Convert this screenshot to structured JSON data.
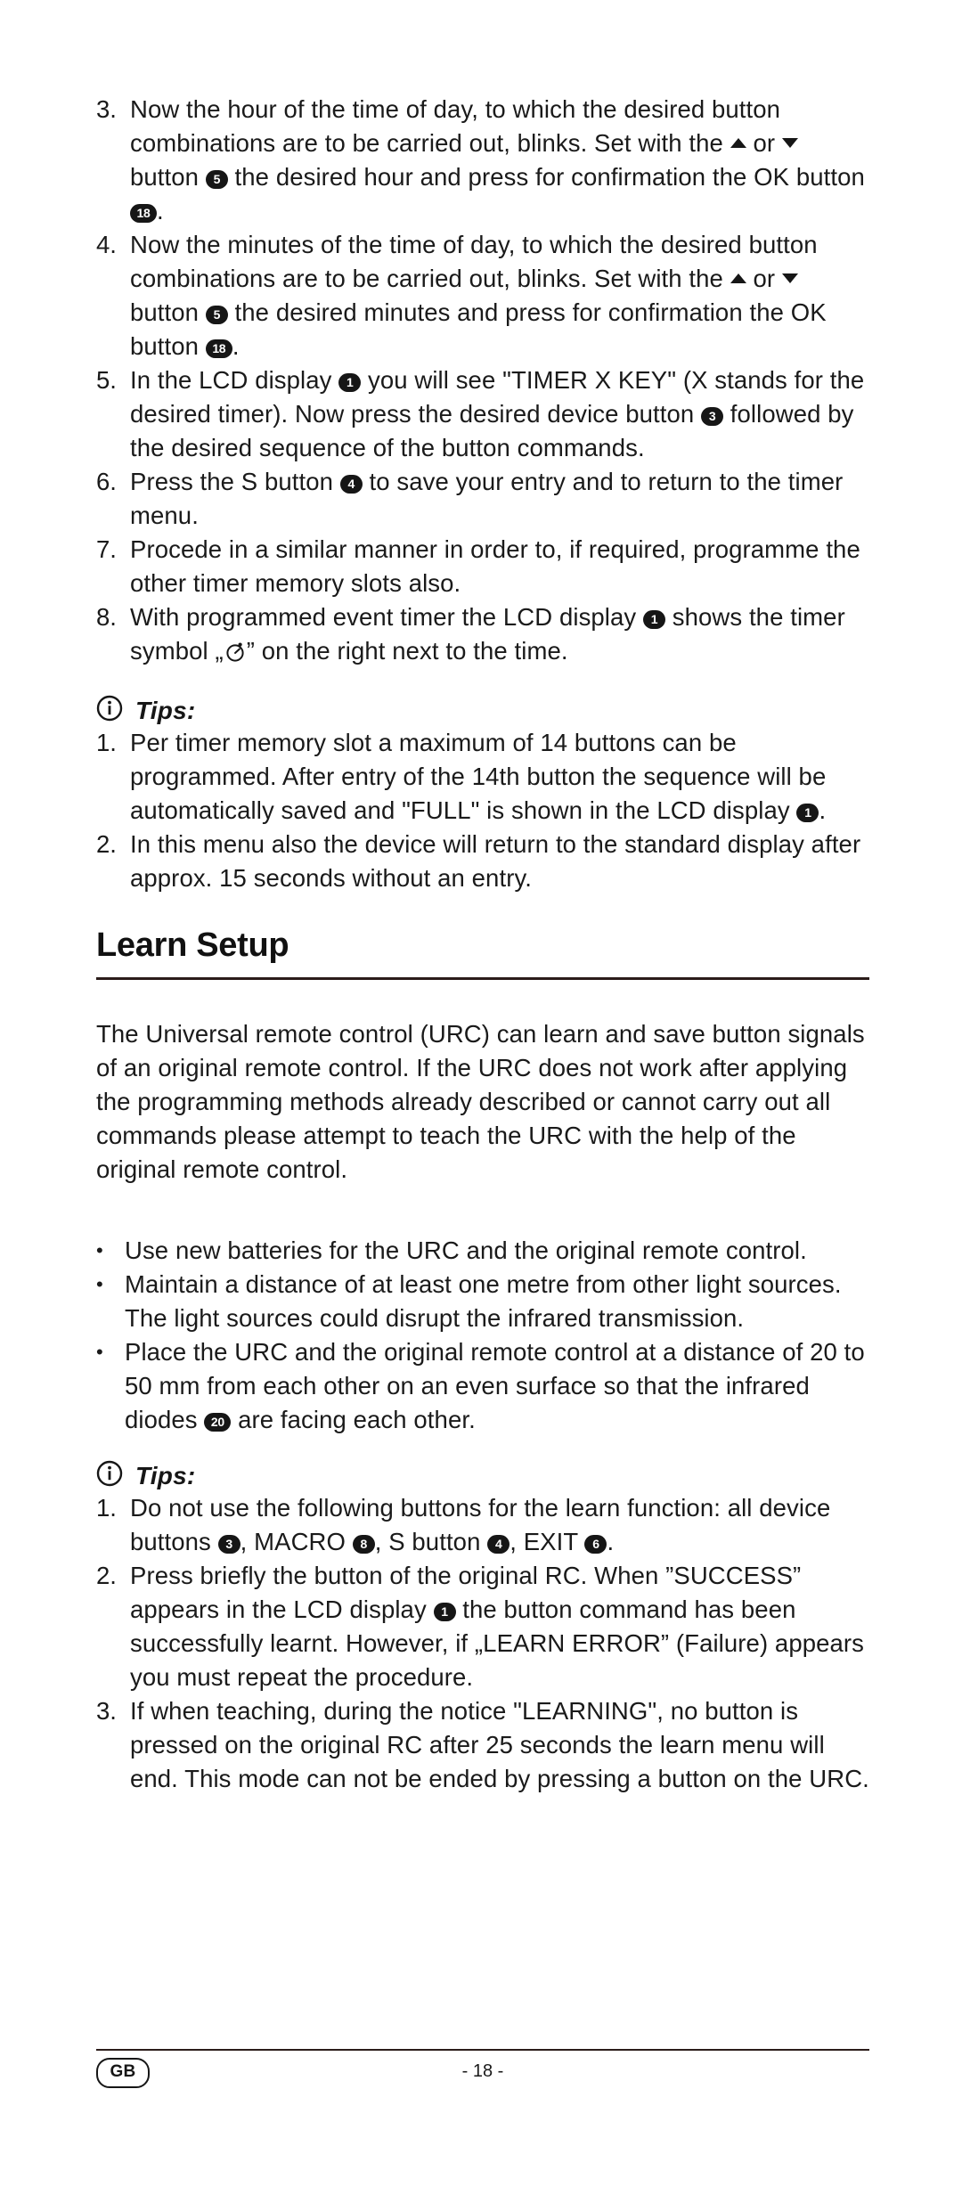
{
  "document": {
    "language_badge": "GB",
    "page_number": "- 18 -"
  },
  "steps_section": {
    "items": [
      {
        "marker": "3.",
        "segments": [
          {
            "t": "Now the hour of the time of day, to which the desired button combinations are to be carried out, blinks. Set with the "
          },
          {
            "icon": "triangle-up"
          },
          {
            "t": " or "
          },
          {
            "icon": "triangle-down"
          },
          {
            "t": " button "
          },
          {
            "badge": "5"
          },
          {
            "t": " the desired hour and press for confirmation the OK button "
          },
          {
            "badge": "18"
          },
          {
            "t": "."
          }
        ]
      },
      {
        "marker": "4.",
        "segments": [
          {
            "t": "Now the minutes of the time of day, to which the desired button combinations are to be carried out, blinks. Set with the "
          },
          {
            "icon": "triangle-up"
          },
          {
            "t": " or "
          },
          {
            "icon": "triangle-down"
          },
          {
            "t": " button "
          },
          {
            "badge": "5"
          },
          {
            "t": " the desired minutes and press for confirmation the OK button "
          },
          {
            "badge": "18"
          },
          {
            "t": "."
          }
        ]
      },
      {
        "marker": "5.",
        "segments": [
          {
            "t": "In the LCD display "
          },
          {
            "badge": "1"
          },
          {
            "t": " you will see \"TIMER X KEY\" (X stands for the desired timer). Now press the desired device button "
          },
          {
            "badge": "3"
          },
          {
            "t": " followed by the desired sequence of the button commands."
          }
        ]
      },
      {
        "marker": "6.",
        "segments": [
          {
            "t": "Press the S button "
          },
          {
            "badge": "4"
          },
          {
            "t": " to save your entry and to return to the timer menu."
          }
        ]
      },
      {
        "marker": "7.",
        "segments": [
          {
            "t": "Procede in a similar manner in order to, if required, programme the other timer memory slots also."
          }
        ]
      },
      {
        "marker": "8.",
        "segments": [
          {
            "t": "With programmed event timer the LCD display "
          },
          {
            "badge": "1"
          },
          {
            "t": " shows the timer symbol „"
          },
          {
            "icon": "timer-symbol"
          },
          {
            "t": "” on the right next to the time."
          }
        ]
      }
    ]
  },
  "tips_one": {
    "icon": "info-icon",
    "label": "Tips:",
    "items": [
      {
        "marker": "1.",
        "segments": [
          {
            "t": "Per timer memory slot a maximum of 14 buttons can be programmed. After entry of the 14th button the sequence will be automatically saved and \"FULL\" is shown in the LCD display "
          },
          {
            "badge": "1"
          },
          {
            "t": "."
          }
        ]
      },
      {
        "marker": "2.",
        "segments": [
          {
            "t": "In this menu also the device will return to the standard display after approx. 15 seconds without an entry."
          }
        ]
      }
    ]
  },
  "learn_setup": {
    "heading": "Learn Setup",
    "intro": "The Universal remote control (URC) can learn and save button signals of an original remote control. If the URC does not work after applying the programming methods already described or cannot carry out all commands please attempt to teach the URC with the help of the original remote control.",
    "bullets": [
      {
        "marker": "•",
        "segments": [
          {
            "t": "Use new batteries for the URC and the original remote control."
          }
        ]
      },
      {
        "marker": "•",
        "segments": [
          {
            "t": "Maintain a distance of at least one metre from other light sources. The light sources could disrupt the infrared transmission."
          }
        ]
      },
      {
        "marker": "•",
        "segments": [
          {
            "t": "Place the URC and the original remote control at a distance of 20 to 50 mm from each other on an even surface so that the infrared diodes "
          },
          {
            "badge": "20"
          },
          {
            "t": " are facing each other."
          }
        ]
      }
    ]
  },
  "tips_two": {
    "icon": "info-icon",
    "label": "Tips:",
    "items": [
      {
        "marker": "1.",
        "segments": [
          {
            "t": "Do not use the following buttons for the learn function: all device buttons "
          },
          {
            "badge": "3"
          },
          {
            "t": ", MACRO "
          },
          {
            "badge": "8"
          },
          {
            "t": ", S button "
          },
          {
            "badge": "4"
          },
          {
            "t": ", EXIT "
          },
          {
            "badge": "6"
          },
          {
            "t": "."
          }
        ]
      },
      {
        "marker": "2.",
        "segments": [
          {
            "t": "Press briefly the button of the original RC. When ”SUCCESS” appears in the LCD display "
          },
          {
            "badge": "1"
          },
          {
            "t": " the button command has been successfully learnt. However, if „LEARN ERROR” (Failure) appears you must repeat the procedure."
          }
        ]
      },
      {
        "marker": "3.",
        "segments": [
          {
            "t": "If when teaching, during the notice \"LEARNING\", no button is pressed on the original RC after 25 seconds the learn menu will end. This mode can not be ended by pressing a button on the URC."
          }
        ]
      }
    ]
  }
}
